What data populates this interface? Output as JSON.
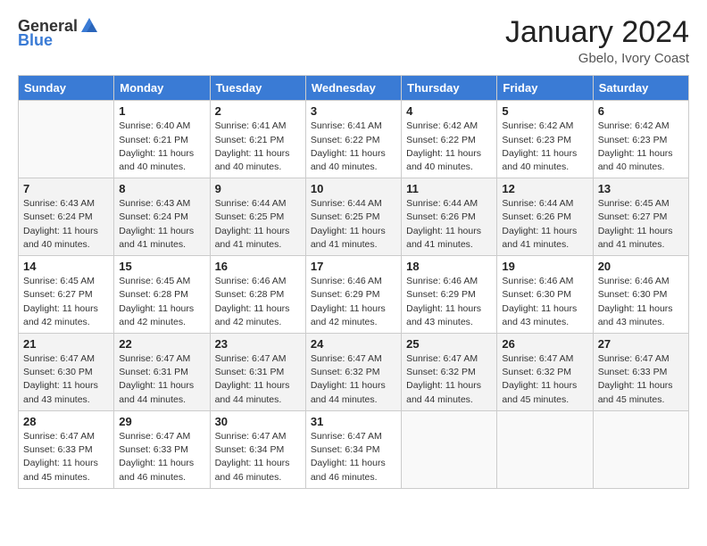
{
  "header": {
    "logo_general": "General",
    "logo_blue": "Blue",
    "main_title": "January 2024",
    "subtitle": "Gbelo, Ivory Coast"
  },
  "days_of_week": [
    "Sunday",
    "Monday",
    "Tuesday",
    "Wednesday",
    "Thursday",
    "Friday",
    "Saturday"
  ],
  "weeks": [
    [
      {
        "day": "",
        "sunrise": "",
        "sunset": "",
        "daylight": ""
      },
      {
        "day": "1",
        "sunrise": "Sunrise: 6:40 AM",
        "sunset": "Sunset: 6:21 PM",
        "daylight": "Daylight: 11 hours and 40 minutes."
      },
      {
        "day": "2",
        "sunrise": "Sunrise: 6:41 AM",
        "sunset": "Sunset: 6:21 PM",
        "daylight": "Daylight: 11 hours and 40 minutes."
      },
      {
        "day": "3",
        "sunrise": "Sunrise: 6:41 AM",
        "sunset": "Sunset: 6:22 PM",
        "daylight": "Daylight: 11 hours and 40 minutes."
      },
      {
        "day": "4",
        "sunrise": "Sunrise: 6:42 AM",
        "sunset": "Sunset: 6:22 PM",
        "daylight": "Daylight: 11 hours and 40 minutes."
      },
      {
        "day": "5",
        "sunrise": "Sunrise: 6:42 AM",
        "sunset": "Sunset: 6:23 PM",
        "daylight": "Daylight: 11 hours and 40 minutes."
      },
      {
        "day": "6",
        "sunrise": "Sunrise: 6:42 AM",
        "sunset": "Sunset: 6:23 PM",
        "daylight": "Daylight: 11 hours and 40 minutes."
      }
    ],
    [
      {
        "day": "7",
        "sunrise": "Sunrise: 6:43 AM",
        "sunset": "Sunset: 6:24 PM",
        "daylight": "Daylight: 11 hours and 40 minutes."
      },
      {
        "day": "8",
        "sunrise": "Sunrise: 6:43 AM",
        "sunset": "Sunset: 6:24 PM",
        "daylight": "Daylight: 11 hours and 41 minutes."
      },
      {
        "day": "9",
        "sunrise": "Sunrise: 6:44 AM",
        "sunset": "Sunset: 6:25 PM",
        "daylight": "Daylight: 11 hours and 41 minutes."
      },
      {
        "day": "10",
        "sunrise": "Sunrise: 6:44 AM",
        "sunset": "Sunset: 6:25 PM",
        "daylight": "Daylight: 11 hours and 41 minutes."
      },
      {
        "day": "11",
        "sunrise": "Sunrise: 6:44 AM",
        "sunset": "Sunset: 6:26 PM",
        "daylight": "Daylight: 11 hours and 41 minutes."
      },
      {
        "day": "12",
        "sunrise": "Sunrise: 6:44 AM",
        "sunset": "Sunset: 6:26 PM",
        "daylight": "Daylight: 11 hours and 41 minutes."
      },
      {
        "day": "13",
        "sunrise": "Sunrise: 6:45 AM",
        "sunset": "Sunset: 6:27 PM",
        "daylight": "Daylight: 11 hours and 41 minutes."
      }
    ],
    [
      {
        "day": "14",
        "sunrise": "Sunrise: 6:45 AM",
        "sunset": "Sunset: 6:27 PM",
        "daylight": "Daylight: 11 hours and 42 minutes."
      },
      {
        "day": "15",
        "sunrise": "Sunrise: 6:45 AM",
        "sunset": "Sunset: 6:28 PM",
        "daylight": "Daylight: 11 hours and 42 minutes."
      },
      {
        "day": "16",
        "sunrise": "Sunrise: 6:46 AM",
        "sunset": "Sunset: 6:28 PM",
        "daylight": "Daylight: 11 hours and 42 minutes."
      },
      {
        "day": "17",
        "sunrise": "Sunrise: 6:46 AM",
        "sunset": "Sunset: 6:29 PM",
        "daylight": "Daylight: 11 hours and 42 minutes."
      },
      {
        "day": "18",
        "sunrise": "Sunrise: 6:46 AM",
        "sunset": "Sunset: 6:29 PM",
        "daylight": "Daylight: 11 hours and 43 minutes."
      },
      {
        "day": "19",
        "sunrise": "Sunrise: 6:46 AM",
        "sunset": "Sunset: 6:30 PM",
        "daylight": "Daylight: 11 hours and 43 minutes."
      },
      {
        "day": "20",
        "sunrise": "Sunrise: 6:46 AM",
        "sunset": "Sunset: 6:30 PM",
        "daylight": "Daylight: 11 hours and 43 minutes."
      }
    ],
    [
      {
        "day": "21",
        "sunrise": "Sunrise: 6:47 AM",
        "sunset": "Sunset: 6:30 PM",
        "daylight": "Daylight: 11 hours and 43 minutes."
      },
      {
        "day": "22",
        "sunrise": "Sunrise: 6:47 AM",
        "sunset": "Sunset: 6:31 PM",
        "daylight": "Daylight: 11 hours and 44 minutes."
      },
      {
        "day": "23",
        "sunrise": "Sunrise: 6:47 AM",
        "sunset": "Sunset: 6:31 PM",
        "daylight": "Daylight: 11 hours and 44 minutes."
      },
      {
        "day": "24",
        "sunrise": "Sunrise: 6:47 AM",
        "sunset": "Sunset: 6:32 PM",
        "daylight": "Daylight: 11 hours and 44 minutes."
      },
      {
        "day": "25",
        "sunrise": "Sunrise: 6:47 AM",
        "sunset": "Sunset: 6:32 PM",
        "daylight": "Daylight: 11 hours and 44 minutes."
      },
      {
        "day": "26",
        "sunrise": "Sunrise: 6:47 AM",
        "sunset": "Sunset: 6:32 PM",
        "daylight": "Daylight: 11 hours and 45 minutes."
      },
      {
        "day": "27",
        "sunrise": "Sunrise: 6:47 AM",
        "sunset": "Sunset: 6:33 PM",
        "daylight": "Daylight: 11 hours and 45 minutes."
      }
    ],
    [
      {
        "day": "28",
        "sunrise": "Sunrise: 6:47 AM",
        "sunset": "Sunset: 6:33 PM",
        "daylight": "Daylight: 11 hours and 45 minutes."
      },
      {
        "day": "29",
        "sunrise": "Sunrise: 6:47 AM",
        "sunset": "Sunset: 6:33 PM",
        "daylight": "Daylight: 11 hours and 46 minutes."
      },
      {
        "day": "30",
        "sunrise": "Sunrise: 6:47 AM",
        "sunset": "Sunset: 6:34 PM",
        "daylight": "Daylight: 11 hours and 46 minutes."
      },
      {
        "day": "31",
        "sunrise": "Sunrise: 6:47 AM",
        "sunset": "Sunset: 6:34 PM",
        "daylight": "Daylight: 11 hours and 46 minutes."
      },
      {
        "day": "",
        "sunrise": "",
        "sunset": "",
        "daylight": ""
      },
      {
        "day": "",
        "sunrise": "",
        "sunset": "",
        "daylight": ""
      },
      {
        "day": "",
        "sunrise": "",
        "sunset": "",
        "daylight": ""
      }
    ]
  ]
}
